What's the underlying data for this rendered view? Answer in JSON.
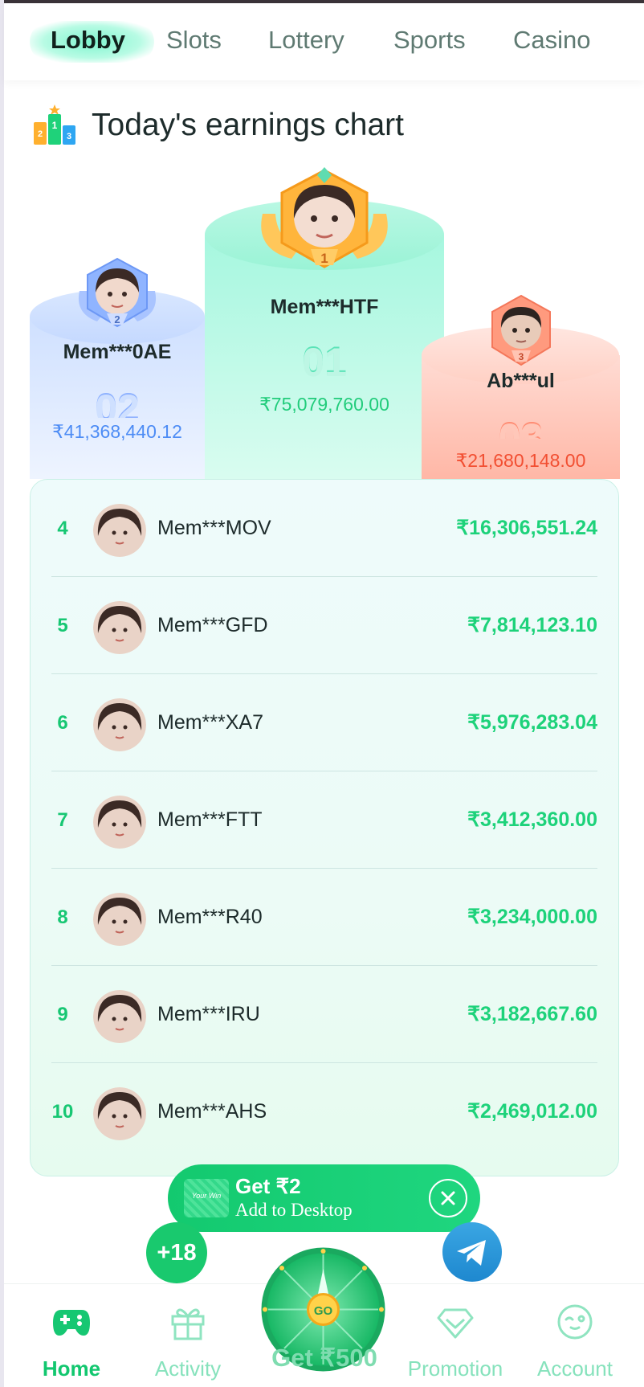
{
  "tabs": [
    {
      "label": "Lobby",
      "active": true
    },
    {
      "label": "Slots",
      "active": false
    },
    {
      "label": "Lottery",
      "active": false
    },
    {
      "label": "Sports",
      "active": false
    },
    {
      "label": "Casino",
      "active": false
    }
  ],
  "chart": {
    "title": "Today's earnings chart",
    "trophy_digits": [
      "2",
      "1",
      "3"
    ]
  },
  "podium": {
    "first": {
      "badge_rank": "1",
      "name": "Mem***HTF",
      "rank": "01",
      "amount": "₹75,079,760.00"
    },
    "second": {
      "badge_rank": "2",
      "name": "Mem***0AE",
      "rank": "02",
      "amount": "₹41,368,440.12"
    },
    "third": {
      "badge_rank": "3",
      "name": "Ab***ul",
      "rank": "03",
      "amount": "₹21,680,148.00"
    }
  },
  "ranking": [
    {
      "rank": "4",
      "name": "Mem***MOV",
      "amount": "₹16,306,551.24"
    },
    {
      "rank": "5",
      "name": "Mem***GFD",
      "amount": "₹7,814,123.10"
    },
    {
      "rank": "6",
      "name": "Mem***XA7",
      "amount": "₹5,976,283.04"
    },
    {
      "rank": "7",
      "name": "Mem***FTT",
      "amount": "₹3,412,360.00"
    },
    {
      "rank": "8",
      "name": "Mem***R40",
      "amount": "₹3,234,000.00"
    },
    {
      "rank": "9",
      "name": "Mem***IRU",
      "amount": "₹3,182,667.60"
    },
    {
      "rank": "10",
      "name": "Mem***AHS",
      "amount": "₹2,469,012.00"
    }
  ],
  "add_desktop": {
    "logo_text": "Your Win",
    "title": "Get ₹2",
    "subtitle": "Add to Desktop"
  },
  "floating": {
    "age_badge": "+18",
    "wheel_center": "GO",
    "wheel_label": "Get ₹500"
  },
  "bottom_nav": [
    {
      "label": "Home",
      "icon": "gamepad-icon",
      "active": true
    },
    {
      "label": "Activity",
      "icon": "gift-icon",
      "active": false
    },
    {
      "label": "Promotion",
      "icon": "diamond-icon",
      "active": false
    },
    {
      "label": "Account",
      "icon": "face-icon",
      "active": false
    }
  ],
  "colors": {
    "brand_green": "#12c76f",
    "rank1": "#5ef3c8",
    "rank2": "#7fb0ff",
    "rank3": "#ff8e7a"
  }
}
